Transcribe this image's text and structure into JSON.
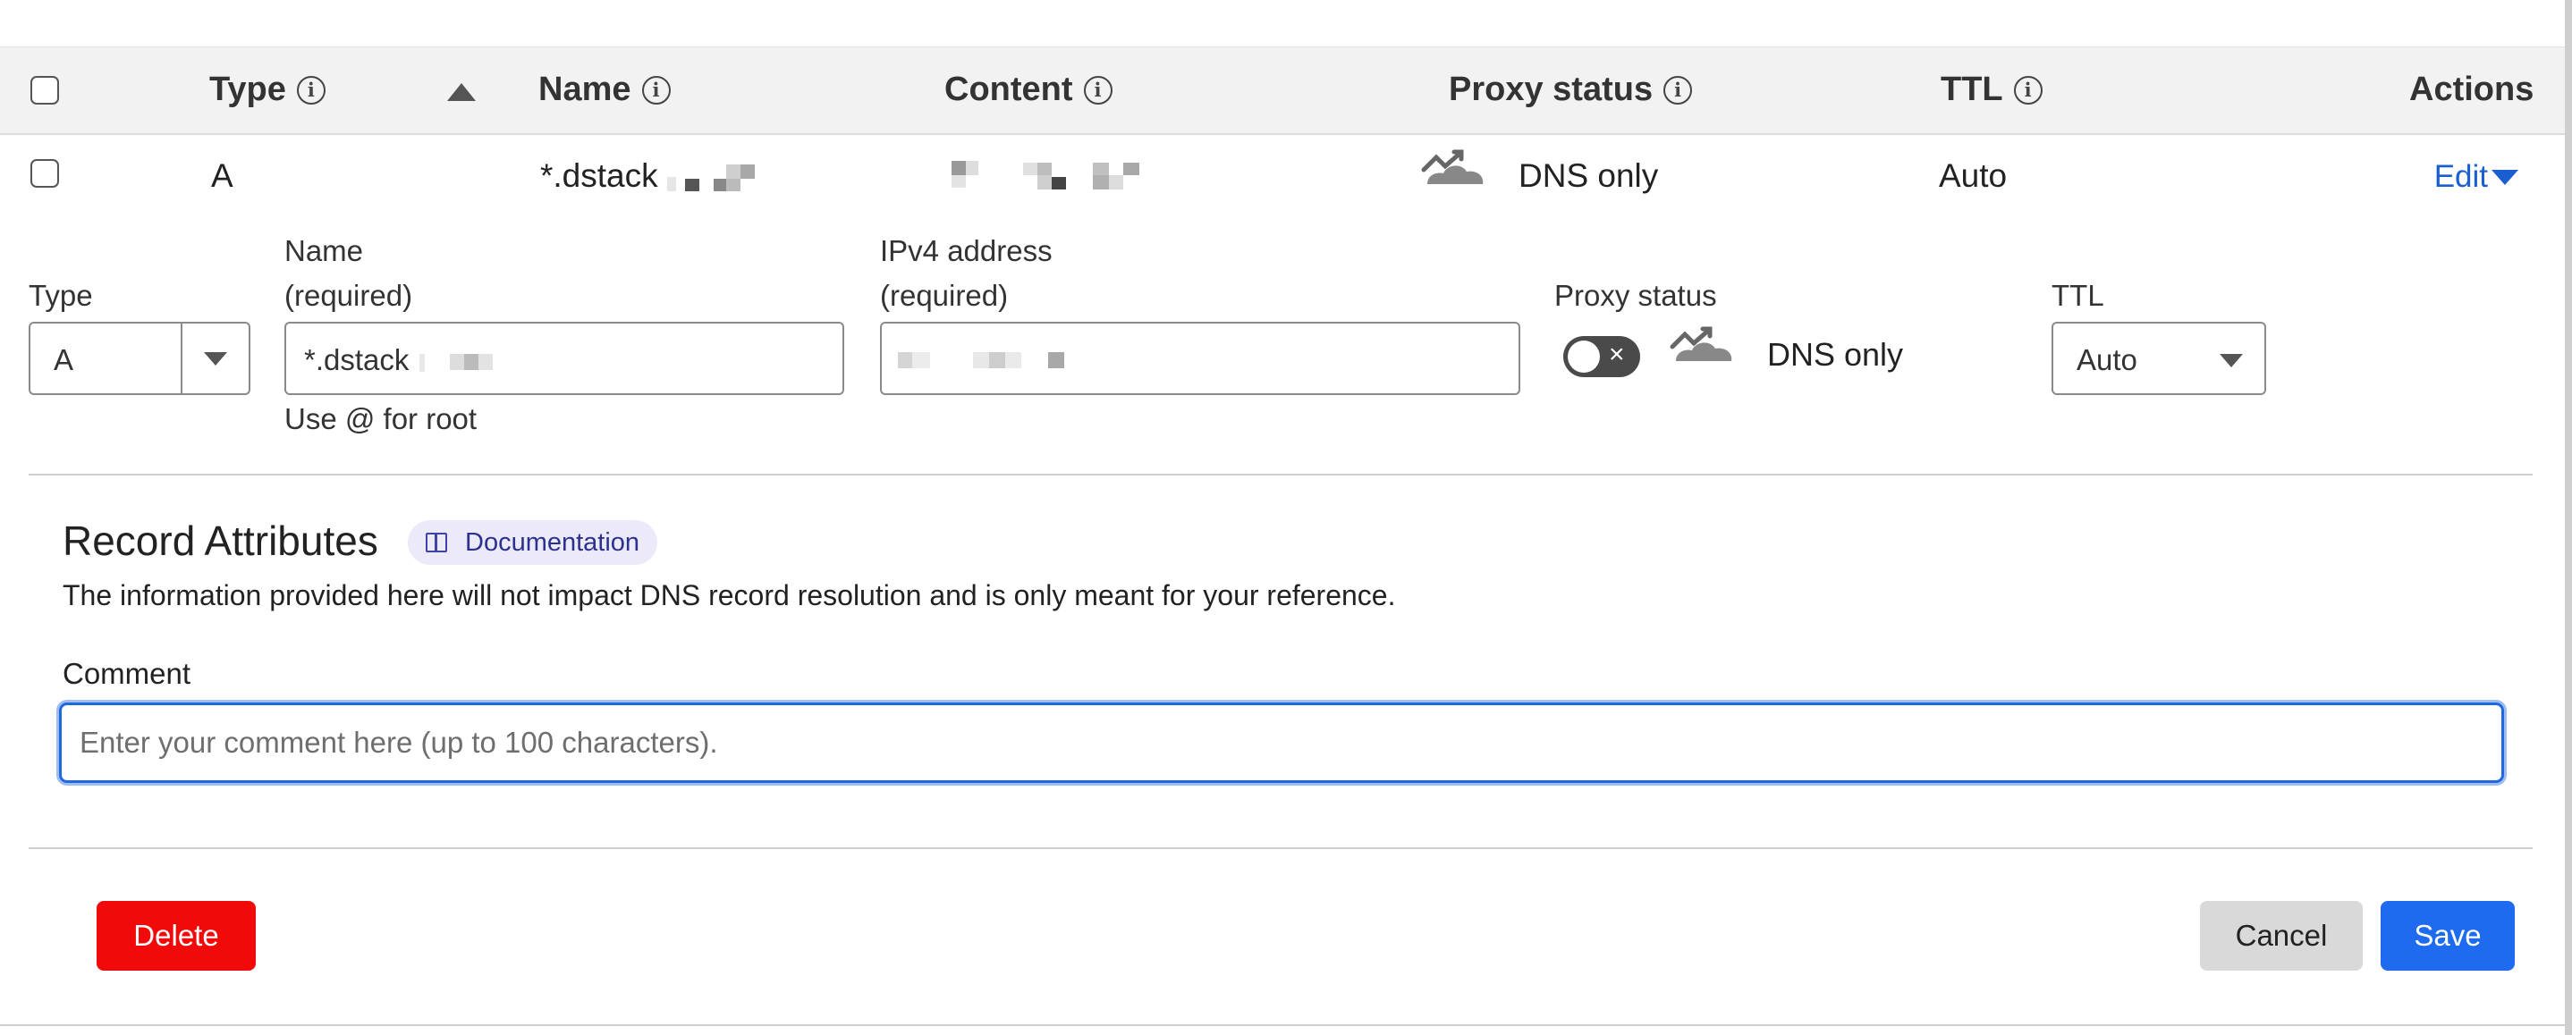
{
  "table": {
    "headers": {
      "type": "Type",
      "name": "Name",
      "content": "Content",
      "proxy_status": "Proxy status",
      "ttl": "TTL",
      "actions": "Actions"
    },
    "info_glyph": "i",
    "sort_icon": "sort-ascending-icon"
  },
  "record": {
    "type": "A",
    "name": "*.dstack",
    "proxy_status": "DNS only",
    "ttl": "Auto",
    "edit_label": "Edit"
  },
  "form": {
    "type_label": "Type",
    "type_value": "A",
    "name_label": "Name",
    "name_required": "(required)",
    "name_value": "*.dstack",
    "name_helper": "Use @ for root",
    "ipv4_label": "IPv4 address",
    "ipv4_required": "(required)",
    "proxy_label": "Proxy status",
    "proxy_value": "DNS only",
    "proxy_enabled": false,
    "ttl_label": "TTL",
    "ttl_value": "Auto"
  },
  "attributes": {
    "heading": "Record Attributes",
    "doc_link": "Documentation",
    "description": "The information provided here will not impact DNS record resolution and is only meant for your reference.",
    "comment_label": "Comment",
    "comment_placeholder": "Enter your comment here (up to 100 characters).",
    "comment_value": ""
  },
  "buttons": {
    "delete": "Delete",
    "cancel": "Cancel",
    "save": "Save"
  },
  "colors": {
    "link_blue": "#1a5fd0",
    "save_blue": "#1f6bf0",
    "delete_red": "#f00a0a",
    "focus_blue": "#1f68e0",
    "doc_pill_bg": "#eceaf9"
  }
}
